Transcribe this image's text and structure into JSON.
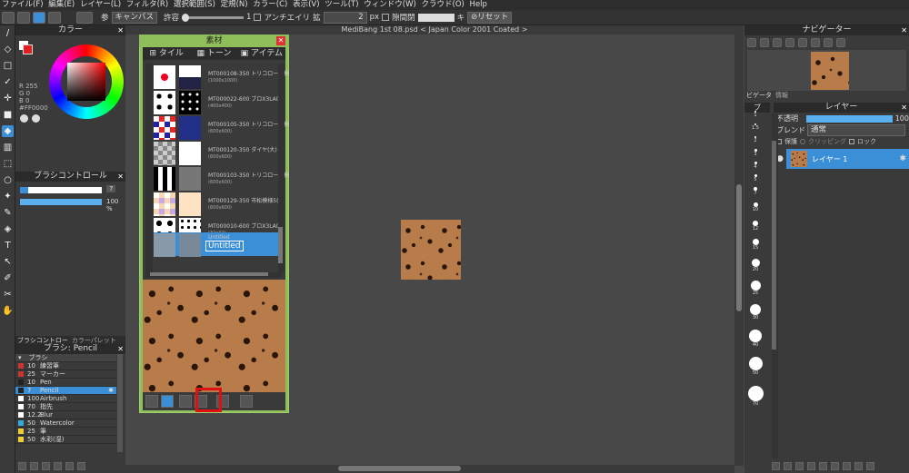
{
  "menu": [
    "ファイル(F)",
    "編集(E)",
    "レイヤー(L)",
    "フィルタ(R)",
    "選択範囲(S)",
    "定規(N)",
    "カラー(C)",
    "表示(V)",
    "ツール(T)",
    "ウィンドウ(W)",
    "クラウド(O)",
    "Help"
  ],
  "toolbar": {
    "ref_label": "参",
    "canvas_select": "キャンバス",
    "tolerance_label": "許容",
    "tolerance_value": "1",
    "antialias_label": "アンチエイリ",
    "expand_label": "拡",
    "expand_value": "2",
    "px_label": "px",
    "closed_label": "隙間閉",
    "key_label": "キ",
    "reset_label": "リセット"
  },
  "document_tab": "MediBang 1st 08.psd < Japan Color 2001 Coated >",
  "color_panel": {
    "title": "カラー",
    "r": "R 255",
    "g": "G 0",
    "b": "B 0",
    "hex": "#FF0000"
  },
  "brush_control": {
    "title": "ブラシコントロール",
    "size": "7",
    "opacity": "100 %"
  },
  "left_tabs": [
    "ブラシコントロー",
    "カラーパレット"
  ],
  "brush_panel": {
    "title": "ブラシ: Pencil",
    "header": "ブラシ",
    "items": [
      {
        "size": "10",
        "name": "練習筆",
        "color": "#c33"
      },
      {
        "size": "25",
        "name": "マーカー",
        "color": "#c33"
      },
      {
        "size": "10",
        "name": "Pen",
        "color": "#222"
      },
      {
        "size": "7",
        "name": "Pencil",
        "color": "#222"
      },
      {
        "size": "100",
        "name": "Airbrush",
        "color": "#fff"
      },
      {
        "size": "70",
        "name": "指先",
        "color": "#fff"
      },
      {
        "size": "12.2",
        "name": "Blur",
        "color": "#fff"
      },
      {
        "size": "50",
        "name": "Watercolor",
        "color": "#3ad"
      },
      {
        "size": "25",
        "name": "筆",
        "color": "#ec3"
      },
      {
        "size": "50",
        "name": "水彩(湿)",
        "color": "#ec3"
      }
    ]
  },
  "material": {
    "title": "素材",
    "tabs": [
      "タイル",
      "トーン",
      "アイテム"
    ],
    "items": [
      {
        "name": "MT000108-350 トリコロール模",
        "size": "(1000x1000)"
      },
      {
        "name": "MT000022-600 ブロX3LA0N",
        "size": "(400x400)"
      },
      {
        "name": "MT000105-350 トリコロール模",
        "size": "(600x600)"
      },
      {
        "name": "MT000120-350 ダイヤ(大)",
        "size": "(600x600)"
      },
      {
        "name": "MT000103-350 トリコロール模",
        "size": "(600x600)"
      },
      {
        "name": "MT000129-350 市松模様5(",
        "size": "(600x600)"
      },
      {
        "name": "MT000010-600 ブロX3LA0N",
        "size": "(32x32)"
      },
      {
        "name": "Untitled",
        "size": "Untitled"
      }
    ]
  },
  "navigator": {
    "title": "ナビゲーター",
    "tabs": [
      "ビゲータ",
      "情報"
    ]
  },
  "layer_panel": {
    "title": "レイヤー",
    "opacity_label": "不透明",
    "opacity_value": "100",
    "blend_label": "ブレンド",
    "blend_value": "通常",
    "protect_label": "保護",
    "clipping_label": "クリッピング",
    "lock_label": "ロック",
    "layer_name": "レイヤー 1",
    "brushsize_title": "ブ"
  },
  "brush_sizes": [
    "1",
    "1.5",
    "2",
    "3",
    "4",
    "5",
    "7",
    "10",
    "12",
    "15",
    "20",
    "25",
    "30",
    "40",
    "50",
    "70"
  ]
}
